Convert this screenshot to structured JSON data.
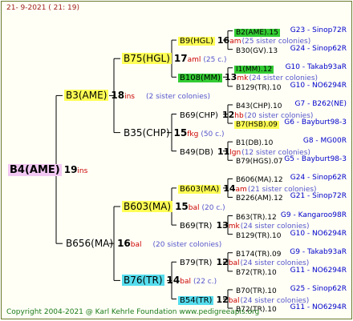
{
  "header": "21-  9-2021 ( 21: 19)",
  "footer": "Copyright 2004-2021 @ Karl Kehrle Foundation   www.pedigreeapis.org",
  "tree": {
    "name": "B4(AME)",
    "num": "19",
    "abbr": "ins",
    "sis": "",
    "dam": {
      "name": "B3(AME)",
      "num": "18",
      "abbr": "ins",
      "sis": "(2 sister colonies)",
      "dam": {
        "name": "B75(HGL)",
        "num": "17",
        "abbr": "aml",
        "sis": "(25 c.)",
        "dam": {
          "name": "B9(HGL)",
          "num": "16",
          "abbr": "am",
          "sis": "(25 sister colonies)",
          "dam": {
            "name": "B2(AME).15",
            "code": "G23 - Sinop72R"
          },
          "sire": {
            "name": "B30(GV).13",
            "code": "G24 - Sinop62R"
          }
        },
        "sire": {
          "name": "B108(MM)",
          "num": "13",
          "abbr": "mk",
          "sis": "(24 sister colonies)",
          "dam": {
            "name": "I1(MM).12",
            "code": "G10 - Takab93aR"
          },
          "sire": {
            "name": "B129(TR).10",
            "code": "G10 - NO6294R"
          }
        }
      },
      "sire": {
        "name": "B35(CHP)",
        "num": "15",
        "abbr": "fkg",
        "sis": "(50 c.)",
        "dam": {
          "name": "B69(CHP)",
          "num": "12",
          "abbr": "hb",
          "sis": "(20 sister colonies)",
          "dam": {
            "name": "B43(CHP).10",
            "code": "G7 - B262(NE)"
          },
          "sire": {
            "name": "B7(HSB).09",
            "code": "G6 - Bayburt98-3"
          }
        },
        "sire": {
          "name": "B49(DB)",
          "num": "11",
          "abbr": "lgn",
          "sis": "(12 sister colonies)",
          "dam": {
            "name": "B1(DB).10",
            "code": "G8 - MG00R"
          },
          "sire": {
            "name": "B79(HGS).07",
            "code": "G5 - Bayburt98-3"
          }
        }
      }
    },
    "sire": {
      "name": "B656(MA)",
      "num": "16",
      "abbr": "bal",
      "sis": "(20 sister colonies)",
      "dam": {
        "name": "B603(MA)",
        "num": "15",
        "abbr": "bal",
        "sis": "(20 c.)",
        "dam": {
          "name": "B603(MA)",
          "num": "14",
          "abbr": "am",
          "sis": "(21 sister colonies)",
          "dam": {
            "name": "B606(MA).12",
            "code": "G24 - Sinop62R"
          },
          "sire": {
            "name": "B226(AM).12",
            "code": "G21 - Sinop72R"
          }
        },
        "sire": {
          "name": "B69(TR)",
          "num": "13",
          "abbr": "mk",
          "sis": "(24 sister colonies)",
          "dam": {
            "name": "B63(TR).12",
            "code": "G9 - Kangaroo98R"
          },
          "sire": {
            "name": "B129(TR).10",
            "code": "G10 - NO6294R"
          }
        }
      },
      "sire": {
        "name": "B76(TR)",
        "num": "14",
        "abbr": "bal",
        "sis": "(22 c.)",
        "dam": {
          "name": "B79(TR)",
          "num": "12",
          "abbr": "bal",
          "sis": "(24 sister colonies)",
          "dam": {
            "name": "B174(TR).09",
            "code": "G9 - Takab93aR"
          },
          "sire": {
            "name": "B72(TR).10",
            "code": "G11 - NO6294R"
          }
        },
        "sire": {
          "name": "B54(TR)",
          "num": "12",
          "abbr": "bal",
          "sis": "(24 sister colonies)",
          "dam": {
            "name": "B70(TR).10",
            "code": "G25 - Sinop62R"
          },
          "sire": {
            "name": "B72(TR).10",
            "code": "G11 - NO6294R"
          }
        }
      }
    }
  },
  "highlight_colors": {
    "yellow": "#ffff55",
    "green": "#33cc33",
    "cyan": "#55ddee",
    "pink": "#f2c8f2"
  },
  "highlights": {
    "tree.name": "pink",
    "tree.dam.name": "yellow",
    "tree.dam.dam.name": "yellow",
    "tree.dam.dam.dam.name": "yellow",
    "tree.dam.dam.dam.dam.name": "green",
    "tree.dam.dam.sire.name": "green",
    "tree.dam.dam.sire.dam.name": "green",
    "tree.dam.sire.dam.sire.name": "yellow",
    "tree.sire.dam.name": "yellow",
    "tree.sire.dam.dam.name": "yellow",
    "tree.sire.sire.name": "cyan",
    "tree.sire.sire.sire.name": "cyan"
  }
}
